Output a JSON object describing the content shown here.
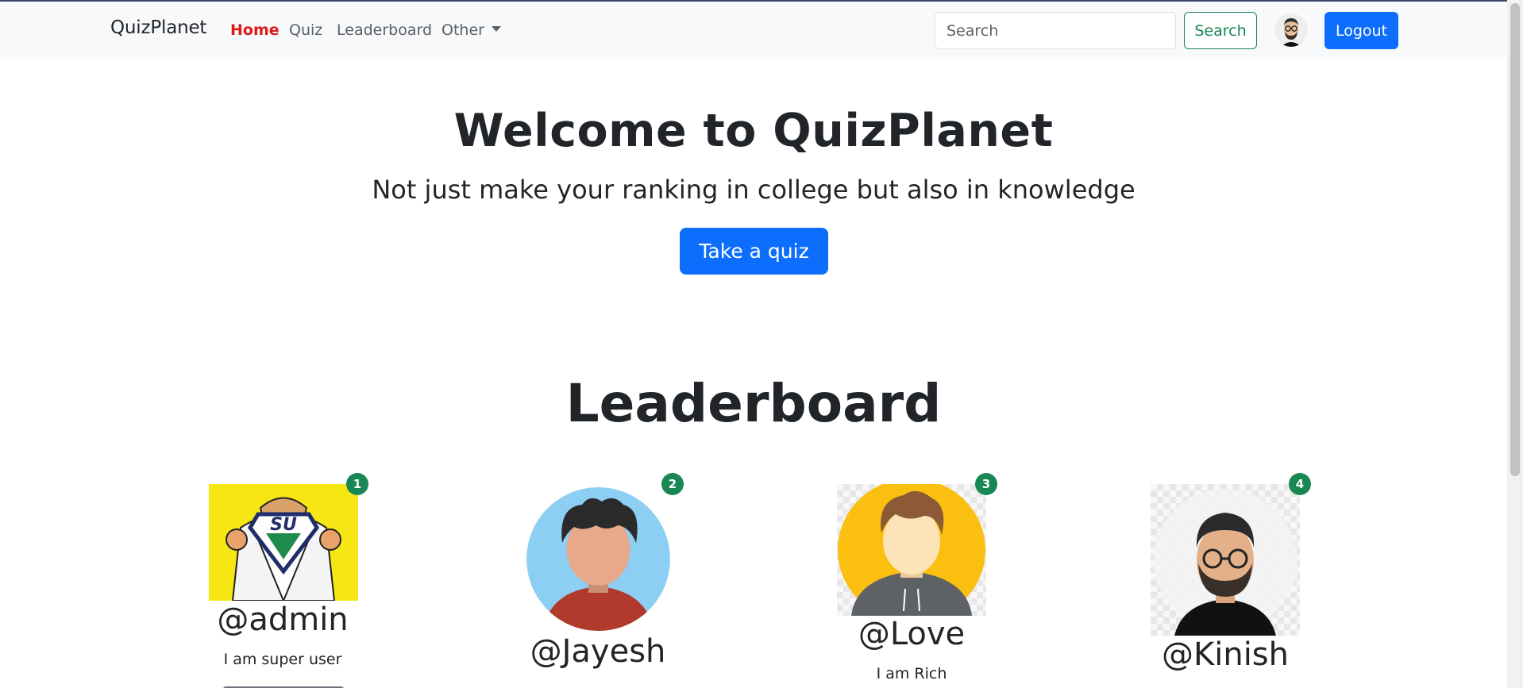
{
  "navbar": {
    "brand": "QuizPlanet",
    "links": [
      {
        "label": "Home",
        "active": true
      },
      {
        "label": "Quiz",
        "active": false
      },
      {
        "label": "Leaderboard",
        "active": false
      },
      {
        "label": "Other",
        "active": false,
        "dropdown": true
      }
    ],
    "search_placeholder": "Search",
    "search_button": "Search",
    "logout_button": "Logout"
  },
  "hero": {
    "title": "Welcome to QuizPlanet",
    "subtitle": "Not just make your ranking in college but also in knowledge",
    "cta": "Take a quiz"
  },
  "leaderboard": {
    "title": "Leaderboard",
    "entries": [
      {
        "rank": "1",
        "username": "@admin",
        "bio": "I am super user"
      },
      {
        "rank": "2",
        "username": "@Jayesh",
        "bio": ""
      },
      {
        "rank": "3",
        "username": "@Love",
        "bio": "I am Rich"
      },
      {
        "rank": "4",
        "username": "@Kinish",
        "bio": ""
      }
    ]
  },
  "colors": {
    "primary": "#0d6efd",
    "success": "#198754",
    "active_nav": "#dc1a1a",
    "navbar_bg": "#f8f9fa"
  }
}
